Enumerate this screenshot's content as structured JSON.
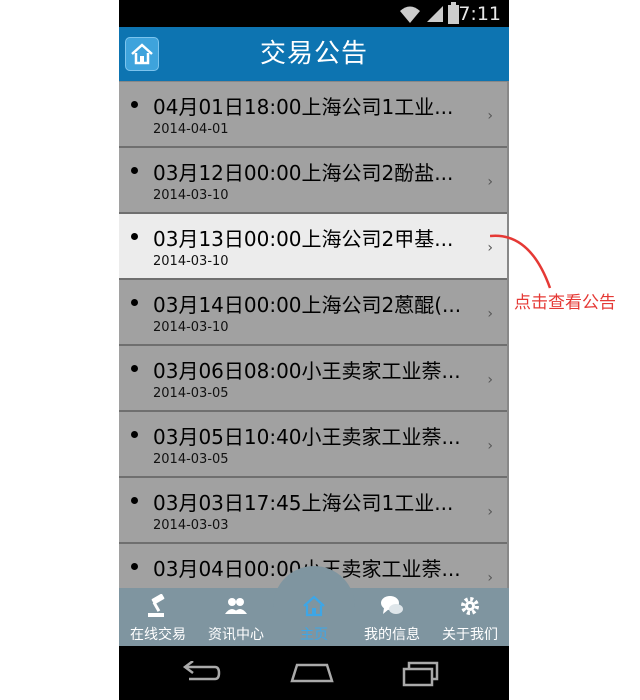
{
  "status": {
    "time": "7:11"
  },
  "header": {
    "title": "交易公告"
  },
  "list": [
    {
      "title": "04月01日18:00上海公司1工业...",
      "date": "2014-04-01",
      "active": false
    },
    {
      "title": "03月12日00:00上海公司2酚盐...",
      "date": "2014-03-10",
      "active": false
    },
    {
      "title": "03月13日00:00上海公司2甲基...",
      "date": "2014-03-10",
      "active": true
    },
    {
      "title": "03月14日00:00上海公司2蒽醌(...",
      "date": "2014-03-10",
      "active": false
    },
    {
      "title": "03月06日08:00小王卖家工业萘...",
      "date": "2014-03-05",
      "active": false
    },
    {
      "title": "03月05日10:40小王卖家工业萘...",
      "date": "2014-03-05",
      "active": false
    },
    {
      "title": "03月03日17:45上海公司1工业...",
      "date": "2014-03-03",
      "active": false
    },
    {
      "title": "03月04日00:00小王卖家工业萘...",
      "date": "",
      "active": false
    }
  ],
  "chevron": "›",
  "tabs": [
    {
      "label": "在线交易",
      "icon": "gavel-icon"
    },
    {
      "label": "资讯中心",
      "icon": "people-icon"
    },
    {
      "label": "主页",
      "icon": "home-icon",
      "active": true
    },
    {
      "label": "我的信息",
      "icon": "chat-icon"
    },
    {
      "label": "关于我们",
      "icon": "gear-icon"
    }
  ],
  "annotation": {
    "text": "点击查看公告",
    "color": "#e53935"
  },
  "colors": {
    "titlebar": "#0d74b1",
    "list_item": "#a1a1a1",
    "list_item_active": "#ececec",
    "tabbar": "#7f95a0",
    "tab_active": "#3ea6e6"
  }
}
